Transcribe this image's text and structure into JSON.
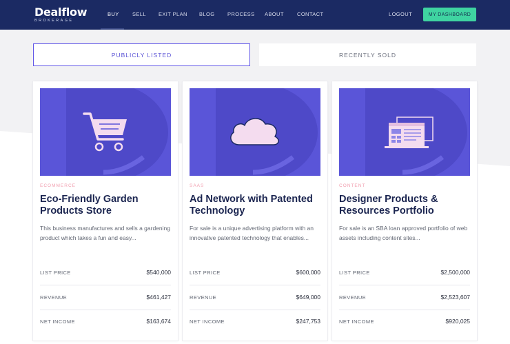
{
  "colors": {
    "nav_bg": "#1b2a63",
    "accent": "#5a55d8",
    "cta": "#3fd4a1",
    "category": "#f2a0b0",
    "title": "#1b2550"
  },
  "nav": {
    "logo": "Dealflow",
    "logo_sub": "BROKERAGE",
    "links": [
      "BUY",
      "SELL",
      "EXIT PLAN",
      "BLOG",
      "PROCESS",
      "ABOUT",
      "CONTACT"
    ],
    "active": "BUY",
    "logout": "LOGOUT",
    "dashboard": "MY DASHBOARD"
  },
  "tabs": {
    "public": "PUBLICLY LISTED",
    "sold": "RECENTLY SOLD",
    "selected": "PUBLICLY LISTED"
  },
  "labels": {
    "list_price": "LIST PRICE",
    "revenue": "REVENUE",
    "net_income": "NET INCOME"
  },
  "listings": [
    {
      "icon": "shopping-cart-icon",
      "category": "ECOMMERCE",
      "title": "Eco-Friendly Garden Products Store",
      "description": "This business manufactures and sells a gardening product which takes a fun and easy...",
      "list_price": "$540,000",
      "revenue": "$461,427",
      "net_income": "$163,674"
    },
    {
      "icon": "cloud-icon",
      "category": "SAAS",
      "title": "Ad Network with Patented Technology",
      "description": "For sale is a unique advertising platform with an innovative patented technology that enables...",
      "list_price": "$600,000",
      "revenue": "$649,000",
      "net_income": "$247,753"
    },
    {
      "icon": "web-content-icon",
      "category": "CONTENT",
      "title": "Designer Products & Resources Portfolio",
      "description": "For sale is an SBA loan approved portfolio of web assets including content sites...",
      "list_price": "$2,500,000",
      "revenue": "$2,523,607",
      "net_income": "$920,025"
    }
  ]
}
